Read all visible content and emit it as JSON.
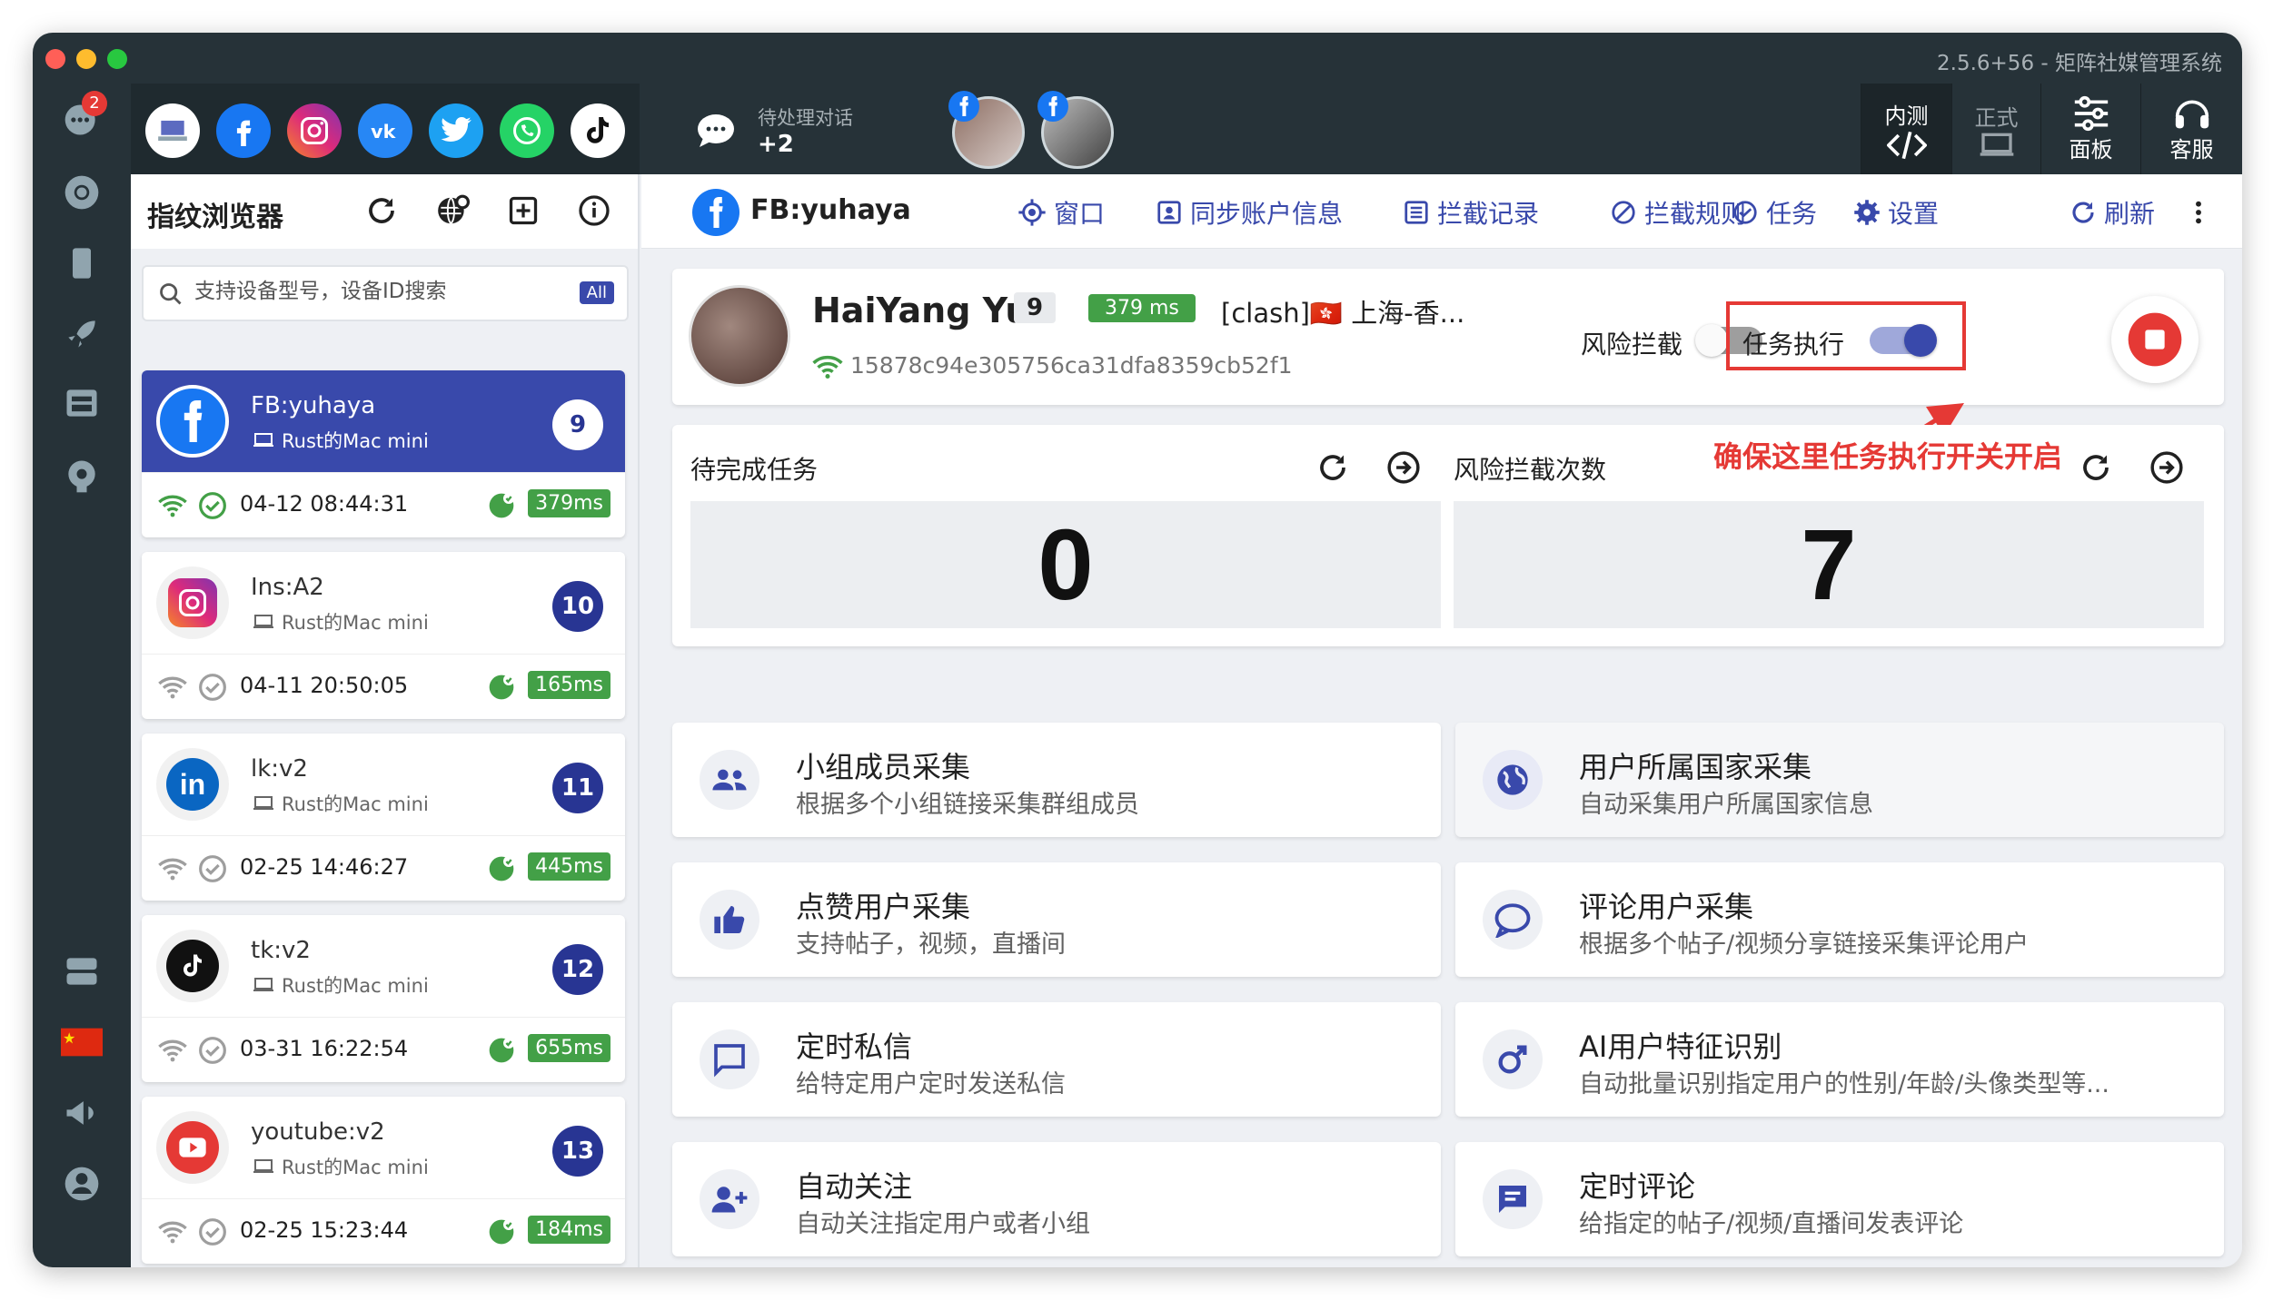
{
  "window": {
    "title": "2.5.6+56 - 矩阵社媒管理系统"
  },
  "rail": {
    "badge_count": "2",
    "flag_label": "CN"
  },
  "topbar": {
    "pending_label": "待处理对话",
    "pending_count": "+2",
    "btn_beta": "内测",
    "btn_prod": "正式",
    "btn_panel": "面板",
    "btn_support": "客服"
  },
  "sidebar": {
    "title": "指纹浏览器",
    "search_placeholder": "支持设备型号，设备ID搜索",
    "search_chip": "All",
    "accounts": [
      {
        "name": "FB:yuhaya",
        "device": "Rust的Mac mini",
        "count": "9",
        "time": "04-12 08:44:31",
        "latency": "379ms"
      },
      {
        "name": "Ins:A2",
        "device": "Rust的Mac mini",
        "count": "10",
        "time": "04-11 20:50:05",
        "latency": "165ms"
      },
      {
        "name": "lk:v2",
        "device": "Rust的Mac mini",
        "count": "11",
        "time": "02-25 14:46:27",
        "latency": "445ms"
      },
      {
        "name": "tk:v2",
        "device": "Rust的Mac mini",
        "count": "12",
        "time": "03-31 16:22:54",
        "latency": "655ms"
      },
      {
        "name": "youtube:v2",
        "device": "Rust的Mac mini",
        "count": "13",
        "time": "02-25 15:23:44",
        "latency": "184ms"
      }
    ]
  },
  "tabbar": {
    "title": "FB:yuhaya",
    "window": "窗口",
    "sync": "同步账户信息",
    "records": "拦截记录",
    "rules": "拦截规则",
    "tasks": "任务",
    "settings": "设置",
    "refresh": "刷新"
  },
  "profile": {
    "name": "HaiYang Yu",
    "count": "9",
    "latency": "379 ms",
    "proxy": "[clash]🇭🇰 上海-香...",
    "id": "15878c94e305756ca31dfa8359cb52f1",
    "risk_label": "风险拦截",
    "risk_enabled": false,
    "task_label": "任务执行",
    "task_enabled": true
  },
  "stats": {
    "pending_label": "待完成任务",
    "pending_value": "0",
    "risk_label": "风险拦截次数",
    "risk_value": "7",
    "annotation": "确保这里任务执行开关开启"
  },
  "features": [
    {
      "title": "小组成员采集",
      "desc": "根据多个小组链接采集群组成员",
      "icon": "group-icon"
    },
    {
      "title": "用户所属国家采集",
      "desc": "自动采集用户所属国家信息",
      "icon": "globe-icon"
    },
    {
      "title": "点赞用户采集",
      "desc": "支持帖子，视频，直播间",
      "icon": "thumb-up-icon"
    },
    {
      "title": "评论用户采集",
      "desc": "根据多个帖子/视频分享链接采集评论用户",
      "icon": "comment-icon"
    },
    {
      "title": "定时私信",
      "desc": "给特定用户定时发送私信",
      "icon": "message-icon"
    },
    {
      "title": "AI用户特征识别",
      "desc": "自动批量识别指定用户的性别/年龄/头像类型等...",
      "icon": "gender-icon"
    },
    {
      "title": "自动关注",
      "desc": "自动关注指定用户或者小组",
      "icon": "add-user-icon"
    },
    {
      "title": "定时评论",
      "desc": "给指定的帖子/视频/直播间发表评论",
      "icon": "chat-box-icon"
    }
  ],
  "colors": {
    "accent": "#3949ab",
    "success": "#43a047",
    "danger": "#e53935",
    "dark": "#263238"
  }
}
